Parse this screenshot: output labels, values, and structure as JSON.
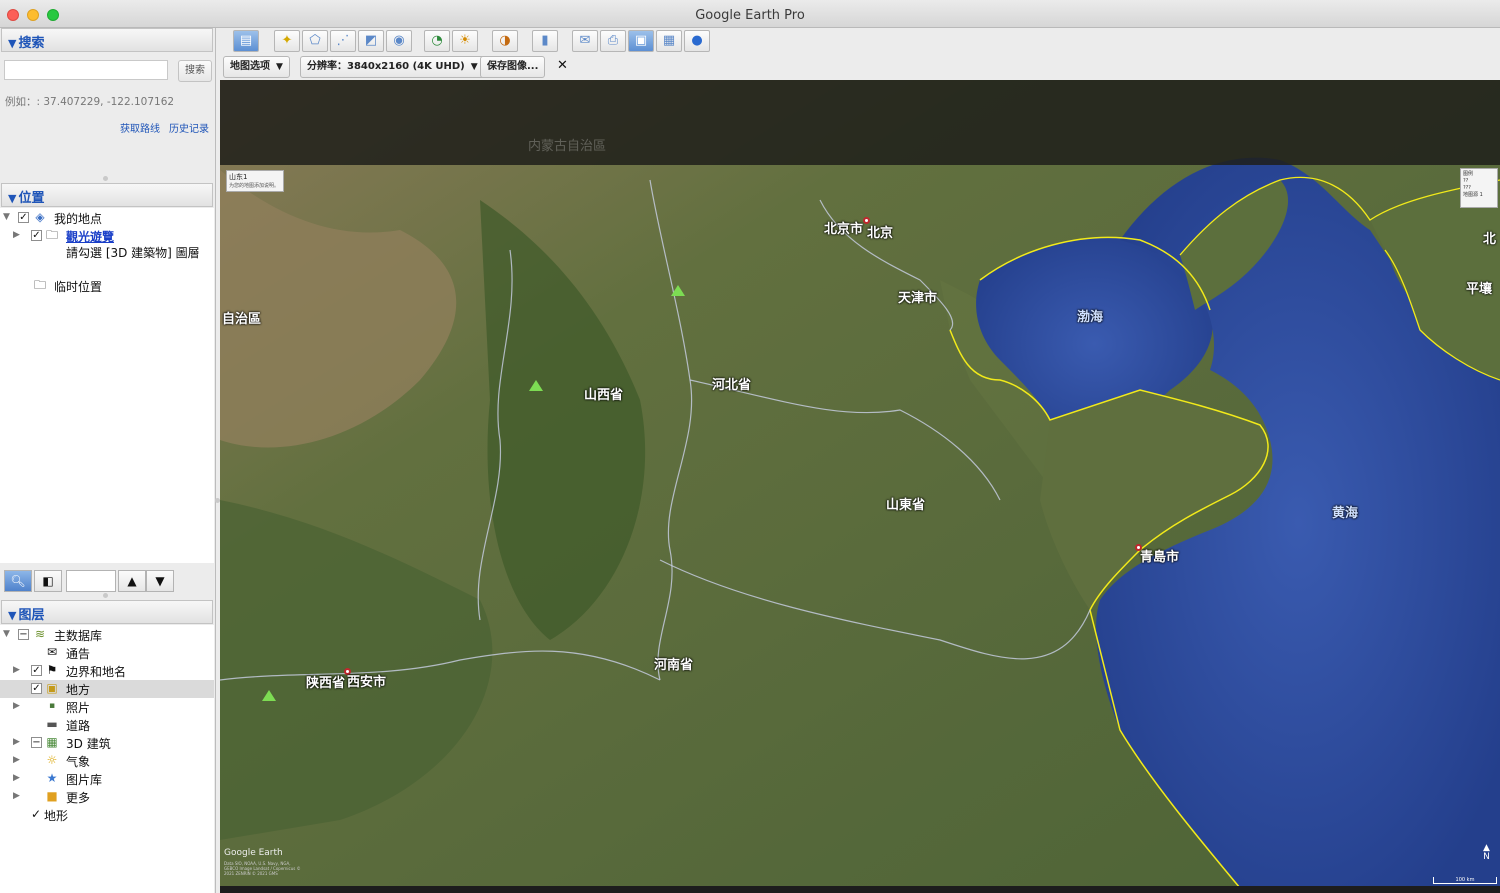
{
  "window": {
    "title": "Google Earth Pro"
  },
  "search": {
    "header": "搜索",
    "placeholder": "",
    "button_label": "搜索",
    "example": "例如：: 37.407229, -122.107162",
    "link_directions": "获取路线",
    "link_history": "历史记录"
  },
  "places": {
    "header": "位置",
    "my_places": "我的地点",
    "tour": "觀光遊覽",
    "tour_hint": "請勾選 [3D 建築物] 圖層",
    "temporary": "临时位置"
  },
  "layers": {
    "header": "图层",
    "primary_db": "主数据库",
    "items": [
      "通告",
      "边界和地名",
      "地方",
      "照片",
      "道路",
      "3D 建筑",
      "气象",
      "图片库",
      "更多"
    ],
    "terrain": "地形"
  },
  "savebar": {
    "map_options": "地图选项",
    "resolution": "分辨率：3840x2160 (4K UHD)",
    "save_image": "保存图像...",
    "close": "✕"
  },
  "map": {
    "labels": {
      "inner_mongolia": "内蒙古自治區",
      "autonomous": "自治區",
      "beijing_city": "北京市",
      "beijing": "北京",
      "tianjin": "天津市",
      "bohai": "渤海",
      "shanxi": "山西省",
      "hebei": "河北省",
      "shandong": "山東省",
      "qingdao": "青島市",
      "yellow_sea": "黄海",
      "henan": "河南省",
      "shaanxi": "陕西省",
      "xian": "西安市",
      "pyongyang": "平壤",
      "bei": "北"
    },
    "title_card": {
      "title": "山东1",
      "subtitle": "为您的地图添加说明。"
    },
    "legend": {
      "title": "图例",
      "items": [
        "??",
        "???",
        "地图源 1"
      ]
    },
    "logo": "Google Earth",
    "credit": "Data SIO, NOAA, U.S. Navy, NGA, GEBCO Image Landsat / Copernicus © 2021 ZENRIN © 2021 GMS",
    "north": "N",
    "scale": "100 km"
  },
  "colors": {
    "accent": "#1f55b8",
    "sea": "#2f4fa0",
    "land": "#556b3a",
    "coast": "#f2ea1a"
  }
}
